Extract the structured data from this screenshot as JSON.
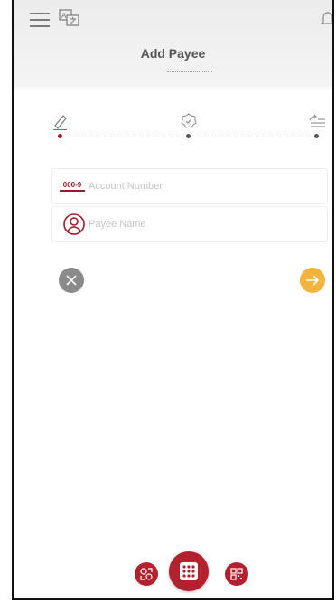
{
  "header": {
    "title": "Add Payee",
    "icons": [
      "menu-icon",
      "language-icon",
      "notification-bell-icon"
    ]
  },
  "steps": [
    {
      "icon": "pencil-icon",
      "active": true
    },
    {
      "icon": "verified-badge-icon",
      "active": false
    },
    {
      "icon": "list-arrow-icon",
      "active": false
    }
  ],
  "form": {
    "account_number": {
      "placeholder": "Account Number",
      "value": "",
      "icon_text": "000-9"
    },
    "payee_name": {
      "placeholder": "Payee Name",
      "value": ""
    }
  },
  "actions": {
    "cancel": {
      "icon": "close-icon",
      "color": "#8a8a8a"
    },
    "next": {
      "icon": "arrow-right-icon",
      "color": "#f3b33d"
    }
  },
  "bottom_nav": {
    "items": [
      "payees-icon",
      "grid-menu-icon",
      "qr-code-icon"
    ],
    "color": "#b5202f"
  },
  "colors": {
    "accent": "#9b1b2a",
    "brand": "#b5202f"
  }
}
